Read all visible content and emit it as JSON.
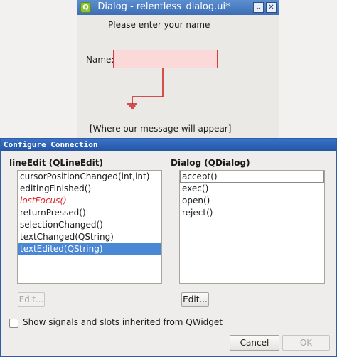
{
  "designer": {
    "window_title": "Dialog - relentless_dialog.ui*",
    "app_icon_glyph": "Q",
    "minimize_glyph": "⌄",
    "close_glyph": "✕",
    "prompt": "Please enter your name",
    "name_label": "Name:",
    "name_value": "",
    "message": "[Where our message will appear]"
  },
  "connection_dialog": {
    "title": "Configure Connection",
    "signals": {
      "group_title": "lineEdit (QLineEdit)",
      "items": [
        "cursorPositionChanged(int,int)",
        "editingFinished()",
        "lostFocus()",
        "returnPressed()",
        "selectionChanged()",
        "textChanged(QString)",
        "textEdited(QString)"
      ],
      "selected_index": 6,
      "obsolete_index": 2,
      "edit_label": "Edit...",
      "edit_enabled": false
    },
    "slots": {
      "group_title": "Dialog (QDialog)",
      "items": [
        "accept()",
        "exec()",
        "open()",
        "reject()"
      ],
      "current_index": 0,
      "edit_label": "Edit...",
      "edit_enabled": true
    },
    "inherit_checkbox": {
      "label": "Show signals and slots inherited from QWidget",
      "checked": false
    },
    "cancel_label": "Cancel",
    "ok_label": "OK",
    "ok_enabled": false
  },
  "colors": {
    "selection": "#4a88d6",
    "obsolete_signal": "#e02020",
    "wire": "#cc1a1a",
    "invalid_input_bg": "#fcd9d9"
  }
}
